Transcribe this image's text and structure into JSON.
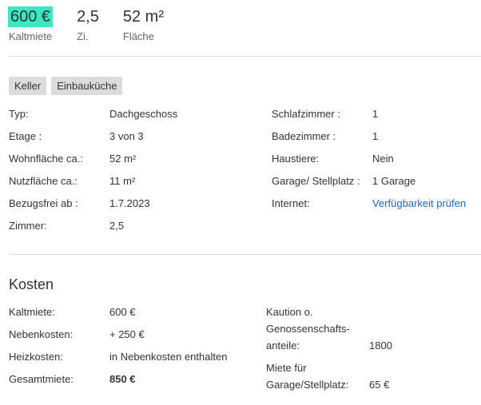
{
  "header": {
    "price_value": "600 €",
    "price_label": "Kaltmiete",
    "rooms_value": "2,5",
    "rooms_label": "Zi.",
    "area_value": "52 m²",
    "area_label": "Fläche"
  },
  "tags": [
    "Keller",
    "Einbauküche"
  ],
  "details_left": [
    {
      "key": "Typ:",
      "value": "Dachgeschoss"
    },
    {
      "key": "Etage :",
      "value": "3 von 3"
    },
    {
      "key": "Wohnfläche ca.:",
      "value": "52 m²"
    },
    {
      "key": "Nutzfläche ca.:",
      "value": "11 m²"
    },
    {
      "key": "Bezugsfrei ab :",
      "value": "1.7.2023"
    },
    {
      "key": "Zimmer:",
      "value": "2,5"
    }
  ],
  "details_right": [
    {
      "key": "Schlafzimmer :",
      "value": "1"
    },
    {
      "key": "Badezimmer :",
      "value": "1"
    },
    {
      "key": "Haustiere:",
      "value": "Nein"
    },
    {
      "key": "Garage/ Stellplatz :",
      "value": "1 Garage"
    },
    {
      "key": "Internet:",
      "value": "Verfügbarkeit prüfen"
    }
  ],
  "costs": {
    "title": "Kosten",
    "left": [
      {
        "key": "Kaltmiete:",
        "value": "600 €"
      },
      {
        "key": "Nebenkosten:",
        "value": "+ 250 €"
      },
      {
        "key": "Heizkosten:",
        "value": "in Nebenkosten enthalten"
      },
      {
        "key": "Gesamtmiete:",
        "value": "850 €"
      }
    ],
    "deposit_key_line1": "Kaution o.",
    "deposit_key_line2": "Genossenschafts-",
    "deposit_key_line3": "anteile:",
    "deposit_value": "1800",
    "garage_key_line1": "Miete für",
    "garage_key_line2": "Garage/Stellplatz:",
    "garage_value": "65 €"
  }
}
